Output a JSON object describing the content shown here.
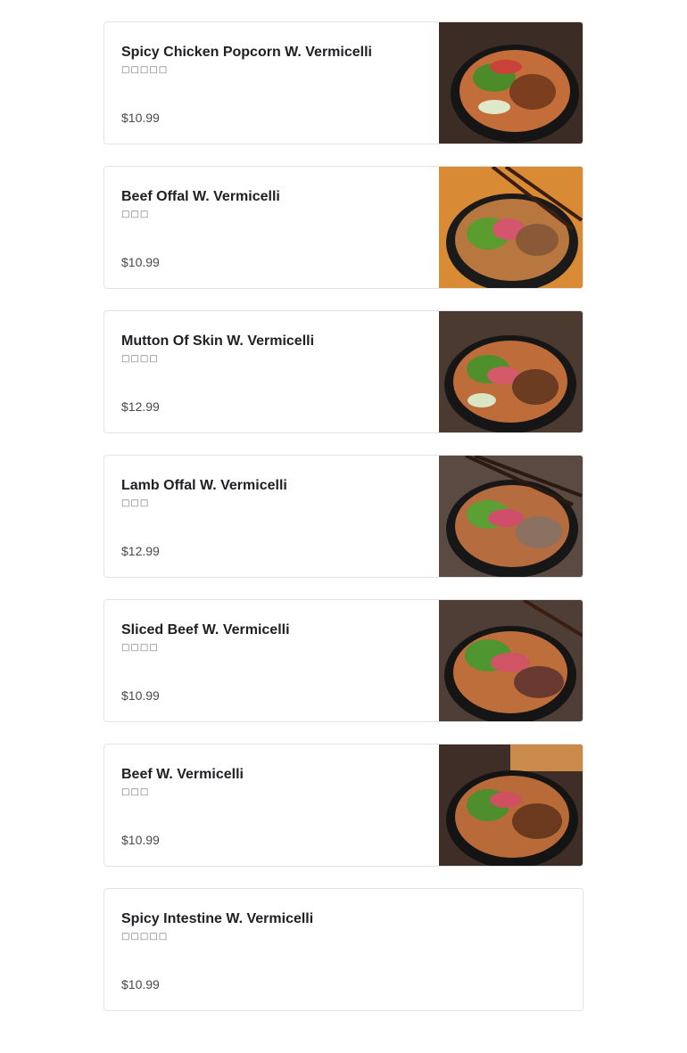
{
  "menu": {
    "items": [
      {
        "name": "",
        "subtitle": "□□□□□",
        "price": "",
        "has_image": true
      },
      {
        "name": "Spicy Chicken Popcorn W. Vermicelli",
        "subtitle": "□□□□□",
        "price": "$10.99",
        "has_image": true
      },
      {
        "name": "Beef Offal W. Vermicelli",
        "subtitle": "□□□",
        "price": "$10.99",
        "has_image": true
      },
      {
        "name": "Mutton Of Skin W. Vermicelli",
        "subtitle": "□□□□",
        "price": "$12.99",
        "has_image": true
      },
      {
        "name": "Lamb Offal W. Vermicelli",
        "subtitle": "□□□",
        "price": "$12.99",
        "has_image": true
      },
      {
        "name": "Sliced Beef W. Vermicelli",
        "subtitle": "□□□□",
        "price": "$10.99",
        "has_image": true
      },
      {
        "name": "Beef W. Vermicelli",
        "subtitle": "□□□",
        "price": "$10.99",
        "has_image": true
      },
      {
        "name": "Spicy Intestine W. Vermicelli",
        "subtitle": "□□□□□",
        "price": "$10.99",
        "has_image": false
      }
    ]
  },
  "colors": {
    "card_border": "#e3e3e3",
    "title_text": "#202125",
    "price_text": "#494949"
  },
  "icons": {
    "dish_photo": "noodle-bowl-photo"
  }
}
